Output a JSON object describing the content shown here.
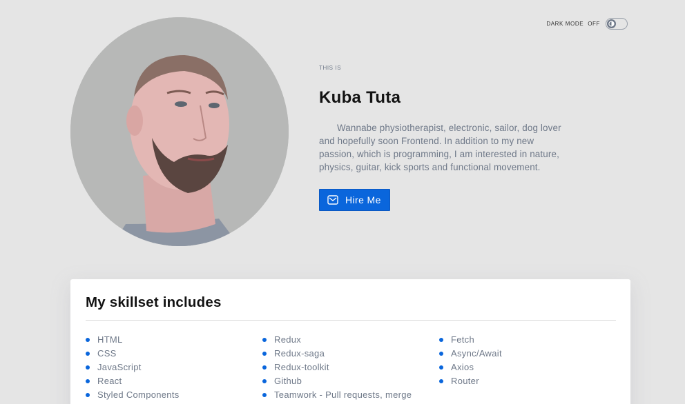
{
  "dark_mode": {
    "label": "DARK MODE",
    "state": "OFF",
    "icon": "moon-icon"
  },
  "hero": {
    "photo_alt": "Profile photo",
    "eyebrow": "THIS IS",
    "name": "Kuba Tuta",
    "bio": "Wannabe physiotherapist, electronic, sailor, dog lover and hopefully soon Frontend. In addition to my new passion, which is programming, I am interested in nature, physics, guitar, kick sports and functional movement.",
    "hire_button": {
      "label": "Hire Me",
      "icon": "mail-icon"
    }
  },
  "skills": {
    "title": "My skillset includes",
    "columns": [
      [
        "HTML",
        "CSS",
        "JavaScript",
        "React",
        "Styled Components"
      ],
      [
        "Redux",
        "Redux-saga",
        "Redux-toolkit",
        "Github",
        "Teamwork - Pull requests, merge"
      ],
      [
        "Fetch",
        "Async/Await",
        "Axios",
        "Router"
      ]
    ]
  },
  "colors": {
    "background": "#e5e5e5",
    "accent": "#0a66dc",
    "text_muted": "#6e7888",
    "heading": "#121212"
  }
}
